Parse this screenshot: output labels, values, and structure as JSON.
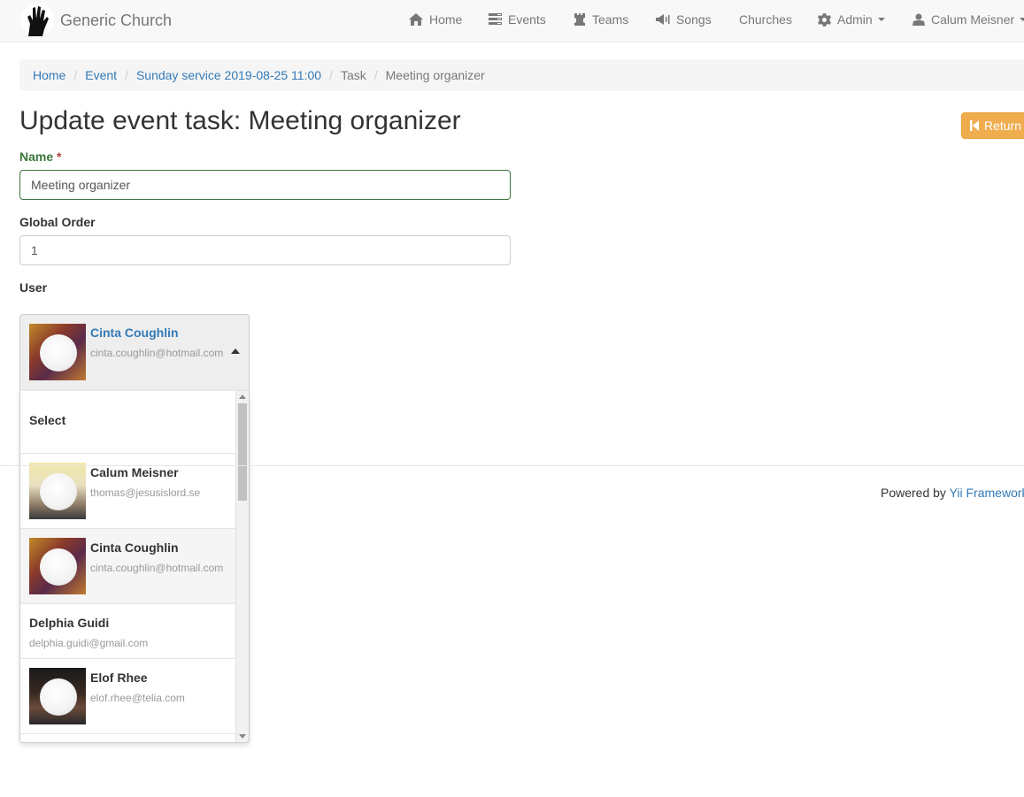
{
  "nav": {
    "brand": "Generic Church",
    "items": [
      {
        "label": "Home",
        "icon": "home-icon"
      },
      {
        "label": "Events",
        "icon": "tasks-icon"
      },
      {
        "label": "Teams",
        "icon": "rook-icon"
      },
      {
        "label": "Songs",
        "icon": "bullhorn-icon"
      },
      {
        "label": "Churches"
      },
      {
        "label": "Admin",
        "icon": "gear-icon"
      },
      {
        "label": "Calum Meisner",
        "icon": "user-icon"
      }
    ]
  },
  "breadcrumb": [
    "Home",
    "Event",
    "Sunday service 2019-08-25 11:00",
    "Task",
    "Meeting organizer"
  ],
  "page": {
    "title": "Update event task: Meeting organizer",
    "return_label": "Return"
  },
  "form": {
    "name_label": "Name",
    "required_mark": "*",
    "name_value": "Meeting organizer",
    "order_label": "Global Order",
    "order_value": "1",
    "user_label": "User",
    "selected_user": {
      "name": "Cinta Coughlin",
      "email": "cinta.coughlin@hotmail.com"
    }
  },
  "dropdown": {
    "placeholder": "Select",
    "options": [
      {
        "name": "Calum Meisner",
        "email": "thomas@jesusislord.se"
      },
      {
        "name": "Cinta Coughlin",
        "email": "cinta.coughlin@hotmail.com"
      },
      {
        "name": "Delphia Guidi",
        "email": "delphia.guidi@gmail.com"
      },
      {
        "name": "Elof Rhee",
        "email": "elof.rhee@telia.com"
      }
    ]
  },
  "footer": {
    "powered_by": "Powered by",
    "framework": "Yii Framework"
  },
  "colors": {
    "link": "#337ab7",
    "warning_button": "#f0ad4e",
    "success_label": "#3c763d",
    "required": "#a94442"
  }
}
